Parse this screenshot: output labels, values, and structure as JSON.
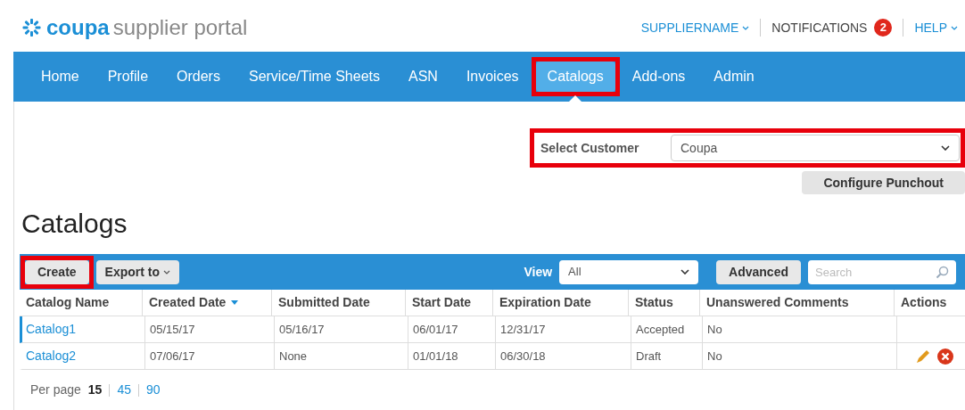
{
  "header": {
    "logo": {
      "brand": "coupa",
      "product": "supplier portal"
    },
    "user_menu": "SUPPLIERNAME",
    "notifications": {
      "label": "NOTIFICATIONS",
      "count": "2"
    },
    "help": "HELP"
  },
  "nav": [
    {
      "label": "Home",
      "selected": false,
      "highlighted": false
    },
    {
      "label": "Profile",
      "selected": false,
      "highlighted": false
    },
    {
      "label": "Orders",
      "selected": false,
      "highlighted": false
    },
    {
      "label": "Service/Time Sheets",
      "selected": false,
      "highlighted": false
    },
    {
      "label": "ASN",
      "selected": false,
      "highlighted": false
    },
    {
      "label": "Invoices",
      "selected": false,
      "highlighted": false
    },
    {
      "label": "Catalogs",
      "selected": true,
      "highlighted": true
    },
    {
      "label": "Add-ons",
      "selected": false,
      "highlighted": false
    },
    {
      "label": "Admin",
      "selected": false,
      "highlighted": false
    }
  ],
  "customer": {
    "label": "Select Customer",
    "value": "Coupa",
    "highlighted": true
  },
  "configure_button": "Configure Punchout",
  "page_title": "Catalogs",
  "toolbar": {
    "create": {
      "label": "Create",
      "highlighted": true
    },
    "export": "Export to",
    "view_label": "View",
    "view_value": "All",
    "advanced": "Advanced",
    "search_placeholder": "Search"
  },
  "table": {
    "columns": [
      {
        "label": "Catalog Name",
        "sorted": false
      },
      {
        "label": "Created Date",
        "sorted": true
      },
      {
        "label": "Submitted Date",
        "sorted": false
      },
      {
        "label": "Start Date",
        "sorted": false
      },
      {
        "label": "Expiration Date",
        "sorted": false
      },
      {
        "label": "Status",
        "sorted": false
      },
      {
        "label": "Unanswered Comments",
        "sorted": false
      },
      {
        "label": "Actions",
        "sorted": false
      }
    ],
    "rows": [
      {
        "selected": true,
        "name": "Catalog1",
        "created": "05/15/17",
        "submitted": "05/16/17",
        "start": "06/01/17",
        "expiration": "12/31/17",
        "status": "Accepted",
        "comments": "No",
        "editable": false
      },
      {
        "selected": false,
        "name": "Catalog2",
        "created": "07/06/17",
        "submitted": "None",
        "start": "01/01/18",
        "expiration": "06/30/18",
        "status": "Draft",
        "comments": "No",
        "editable": true
      }
    ]
  },
  "pagination": {
    "label": "Per page",
    "options": [
      {
        "label": "15",
        "selected": true
      },
      {
        "label": "45",
        "selected": false
      },
      {
        "label": "90",
        "selected": false
      }
    ]
  }
}
